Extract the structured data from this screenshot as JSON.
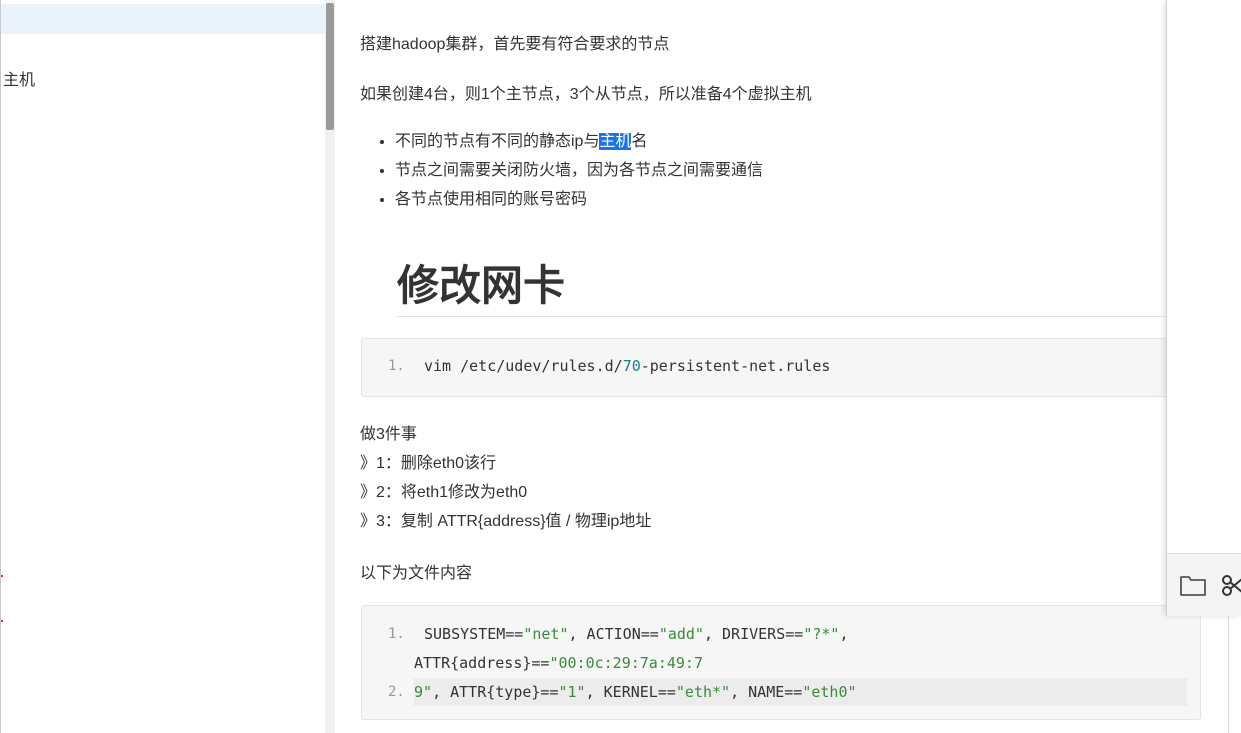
{
  "sidebar": {
    "item_label": "主机"
  },
  "article": {
    "p1": "搭建hadoop集群，首先要有符合要求的节点",
    "p2": "如果创建4台，则1个主节点，3个从节点，所以准备4个虚拟主机",
    "bullets": [
      {
        "before": "不同的节点有不同的静态ip与",
        "highlight": "主机",
        "after": "名"
      },
      {
        "text": "节点之间需要关闭防火墙，因为各节点之间需要通信"
      },
      {
        "text": "各节点使用相同的账号密码"
      }
    ],
    "heading": "修改网卡",
    "code1": {
      "line_no": "1.",
      "path_a": "vim /etc/udev/rules.d/",
      "path_num": "70",
      "path_b": "-persistent-net.rules"
    },
    "steps": [
      "做3件事",
      "》1：删除eth0该行",
      "》2：将eth1修改为eth0",
      "》3：复制 ATTR{address}值 / 物理ip地址"
    ],
    "file_intro": "以下为文件内容",
    "code2": {
      "line1_no": "1.",
      "line2_no": "2.",
      "subsystem_key": "SUBSYSTEM==",
      "subsystem_val": "\"net\"",
      "action_key": ", ACTION==",
      "action_val": "\"add\"",
      "drivers_key": ", DRIVERS==",
      "drivers_val": "\"?*\"",
      "drivers_end": ",",
      "attr_key": "ATTR{address}==",
      "attr_val": "\"00:0c:29:7a:49:7",
      "cont_val": "9\"",
      "type_key": ", ATTR{type}==",
      "type_val": "\"1\"",
      "kernel_key": ", KERNEL==",
      "kernel_val": "\"eth*\"",
      "name_key": ", NAME==",
      "name_val": "\"eth0\""
    }
  },
  "panel": {
    "icons": [
      "folder-icon",
      "scissors-icon"
    ]
  }
}
